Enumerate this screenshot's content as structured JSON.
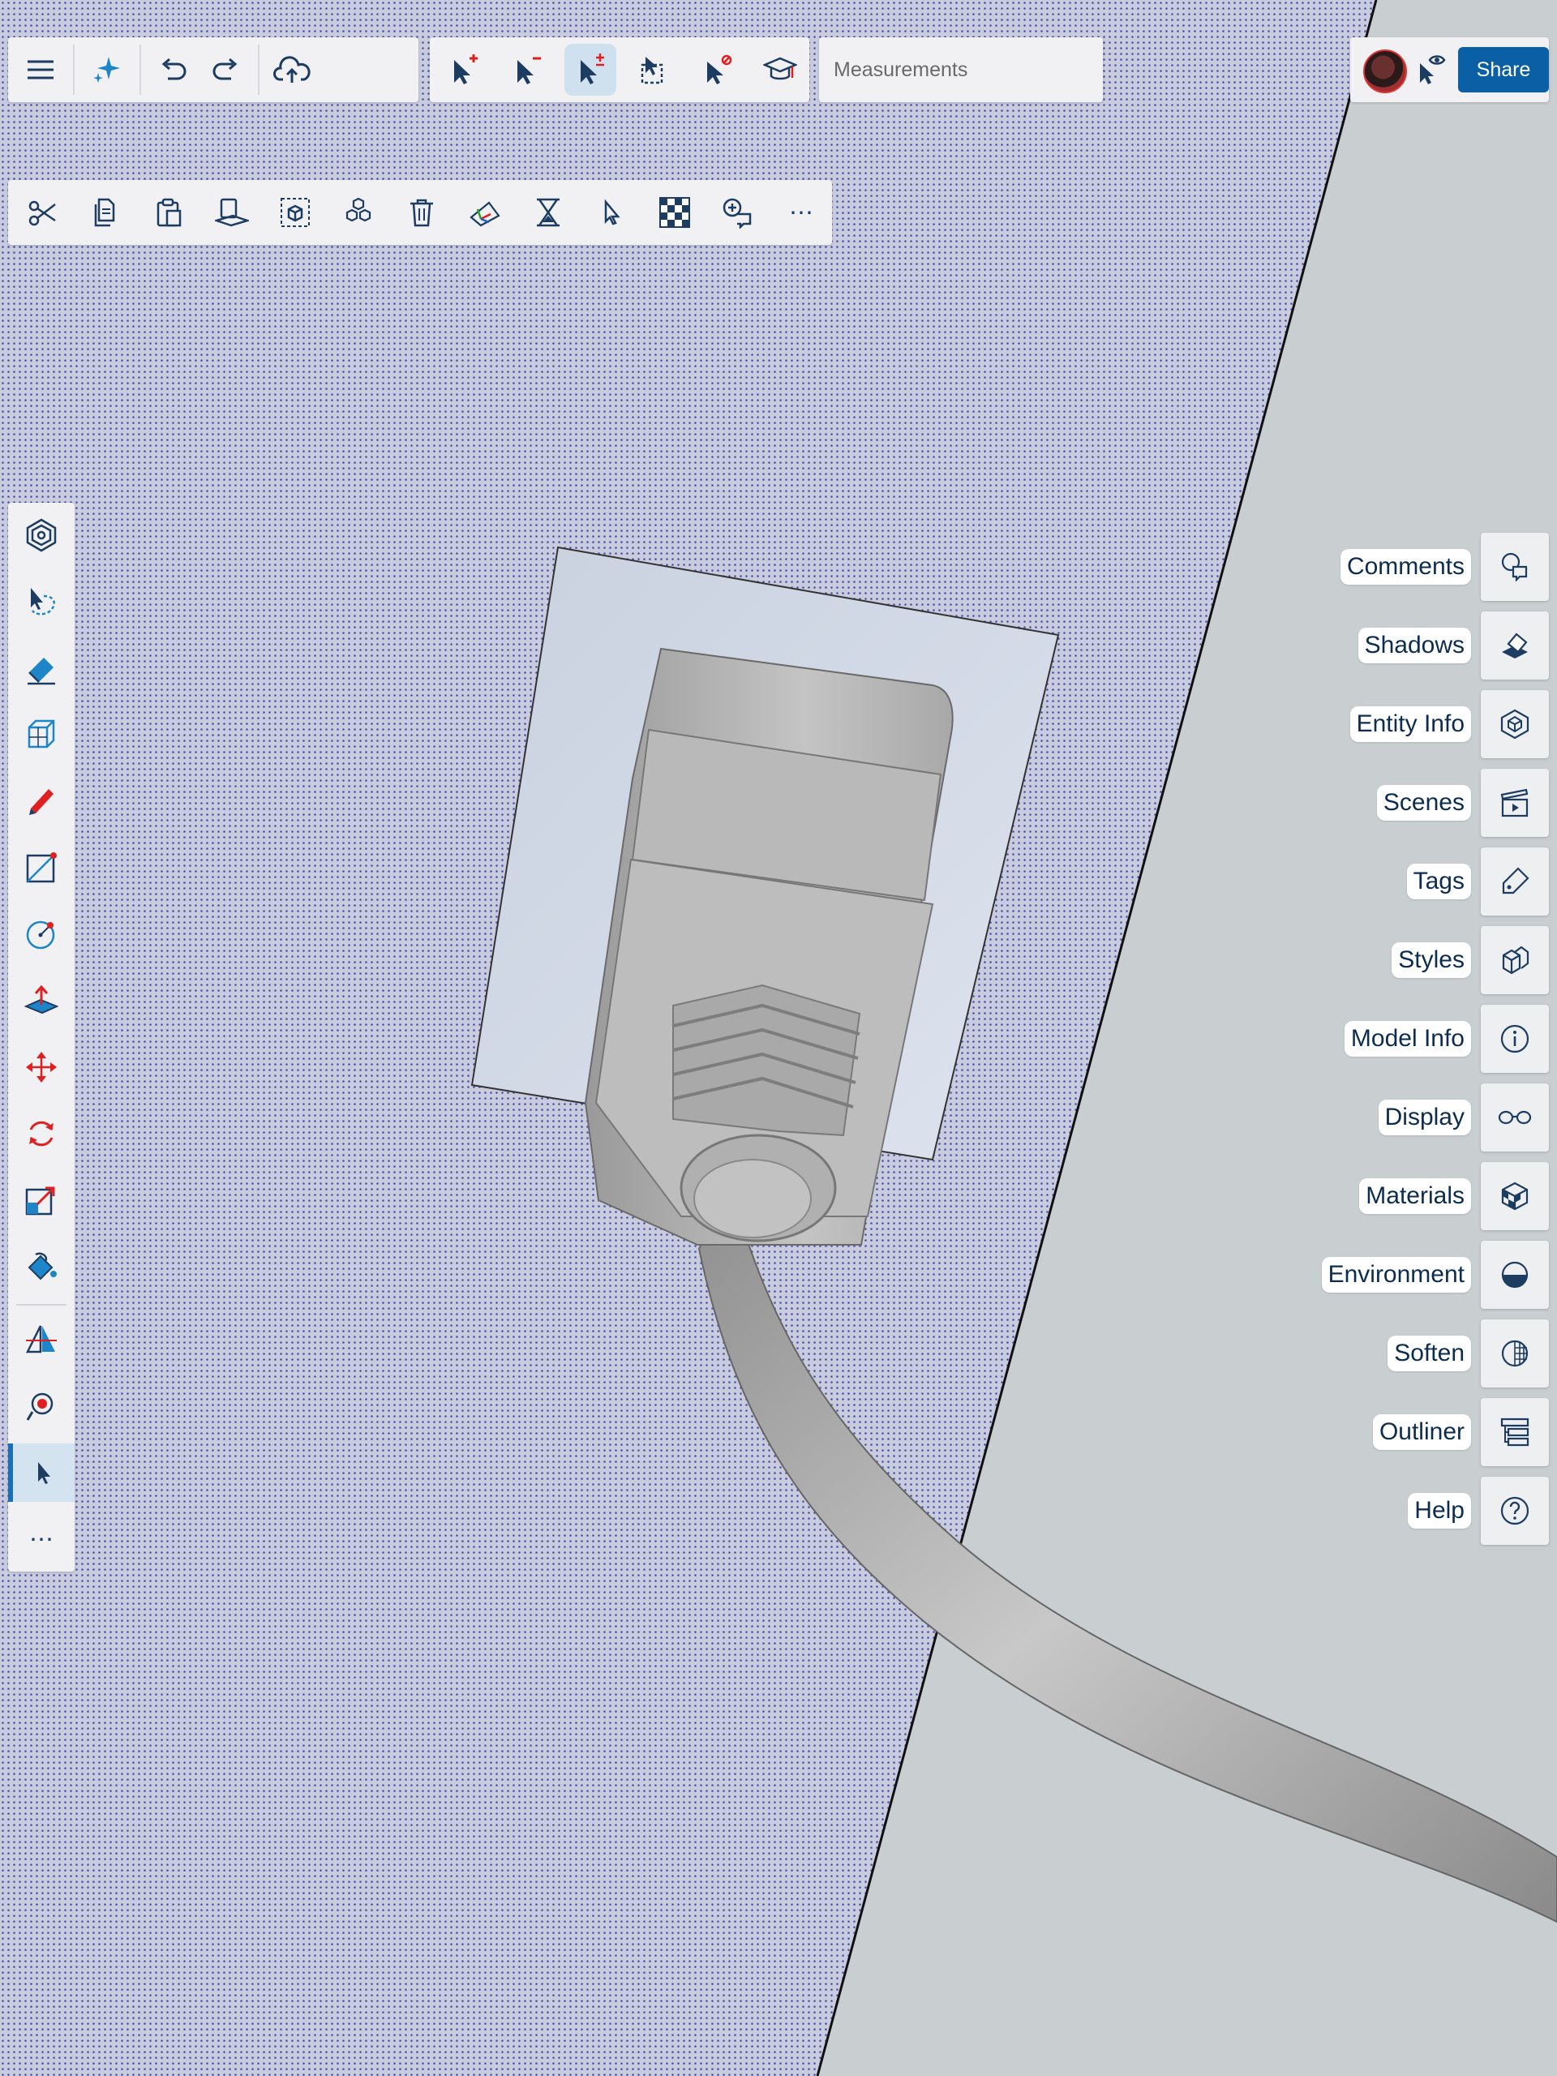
{
  "app": {
    "accent_color": "#0b5fa5",
    "icon_color": "#1d3c62",
    "tool_red": "#e02020"
  },
  "toolbar_main": [
    {
      "name": "hamburger-menu-icon"
    },
    {
      "name": "sparkle-ai-icon"
    },
    {
      "name": "undo-icon"
    },
    {
      "name": "redo-icon"
    },
    {
      "name": "cloud-upload-icon"
    }
  ],
  "toolbar_select": [
    {
      "name": "select-add-icon"
    },
    {
      "name": "select-subtract-icon"
    },
    {
      "name": "select-toggle-icon",
      "active": true
    },
    {
      "name": "select-box-icon"
    },
    {
      "name": "select-none-icon"
    },
    {
      "name": "instructor-icon"
    }
  ],
  "measurements": {
    "placeholder": "Measurements",
    "value": ""
  },
  "header_right": {
    "avatar": "user-avatar",
    "view_icon": "view-mode-icon",
    "share_label": "Share"
  },
  "toolbar_edit": [
    {
      "name": "cut-icon"
    },
    {
      "name": "copy-icon"
    },
    {
      "name": "paste-icon"
    },
    {
      "name": "paste-in-place-icon"
    },
    {
      "name": "make-group-icon"
    },
    {
      "name": "make-component-icon"
    },
    {
      "name": "delete-icon"
    },
    {
      "name": "axes-icon"
    },
    {
      "name": "hourglass-icon"
    },
    {
      "name": "select-arrow-icon"
    },
    {
      "name": "checker-material-icon"
    },
    {
      "name": "add-comment-icon"
    },
    {
      "name": "more-icon",
      "label": "⋯"
    }
  ],
  "left_tools": [
    {
      "name": "solid-tools-icon"
    },
    {
      "name": "lasso-select-icon"
    },
    {
      "name": "eraser-icon"
    },
    {
      "name": "orbit-cube-icon"
    },
    {
      "name": "pencil-icon"
    },
    {
      "name": "rectangle-icon"
    },
    {
      "name": "circle-icon"
    },
    {
      "name": "push-pull-icon"
    },
    {
      "name": "move-icon"
    },
    {
      "name": "rotate-icon"
    },
    {
      "name": "scale-icon"
    },
    {
      "name": "paint-bucket-icon"
    },
    {
      "name": "section-plane-icon"
    },
    {
      "name": "position-camera-icon"
    },
    {
      "name": "select-tool-icon",
      "active": true
    },
    {
      "name": "more-tools-icon",
      "label": "⋯"
    }
  ],
  "right_panels": [
    {
      "label": "Comments",
      "icon": "comments-icon"
    },
    {
      "label": "Shadows",
      "icon": "shadows-icon"
    },
    {
      "label": "Entity Info",
      "icon": "entity-info-icon"
    },
    {
      "label": "Scenes",
      "icon": "scenes-icon"
    },
    {
      "label": "Tags",
      "icon": "tags-icon"
    },
    {
      "label": "Styles",
      "icon": "styles-icon"
    },
    {
      "label": "Model Info",
      "icon": "model-info-icon"
    },
    {
      "label": "Display",
      "icon": "display-icon"
    },
    {
      "label": "Materials",
      "icon": "materials-icon"
    },
    {
      "label": "Environment",
      "icon": "environment-icon"
    },
    {
      "label": "Soften",
      "icon": "soften-icon"
    },
    {
      "label": "Outliner",
      "icon": "outliner-icon"
    },
    {
      "label": "Help",
      "icon": "help-icon"
    }
  ]
}
